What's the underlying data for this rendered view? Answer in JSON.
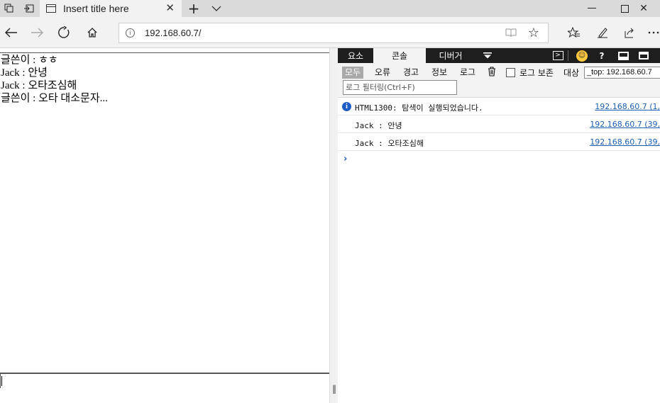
{
  "browser": {
    "tab": {
      "title": "Insert title here"
    },
    "address": {
      "url": "192.168.60.7/"
    }
  },
  "page": {
    "messages": [
      {
        "author": "글쓴이",
        "sep": " : ",
        "text": "ㅎㅎ"
      },
      {
        "author": "Jack",
        "sep": " : ",
        "text": "안녕"
      },
      {
        "author": "Jack",
        "sep": " : ",
        "text": "오타조심해"
      },
      {
        "author": "글쓴이",
        "sep": " : ",
        "text": "오타 대소문자..."
      }
    ],
    "input": {
      "value": ""
    }
  },
  "devtools": {
    "tabs": [
      "요소",
      "콘솔",
      "디버거"
    ],
    "active_tab": "콘솔",
    "levels": [
      "모두",
      "오류",
      "경고",
      "정보",
      "로그"
    ],
    "active_level": "모두",
    "preserve_log_label": "로그 보존",
    "target_label": "대상",
    "target_value": "_top: 192.168.60.7",
    "filter_placeholder": "로그 필터링(Ctrl+F)",
    "logs": [
      {
        "type": "info",
        "text": "HTML1300: 탐색이 실행되었습니다.",
        "source": "192.168.60.7 (1,"
      },
      {
        "type": "log",
        "text": "Jack : 안녕",
        "source": "192.168.60.7 (39,"
      },
      {
        "type": "log",
        "text": "Jack : 오타조심해",
        "source": "192.168.60.7 (39,"
      }
    ],
    "prompt": "›"
  }
}
